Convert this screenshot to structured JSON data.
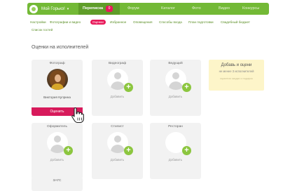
{
  "header": {
    "brand": "Мой Горько!",
    "nav": [
      {
        "label": "Переписка",
        "badge": "0",
        "active": true
      },
      {
        "label": "Форум"
      },
      {
        "label": "Каталог"
      },
      {
        "label": "Фото"
      },
      {
        "label": "Видео"
      },
      {
        "label": "Конкурсы"
      }
    ]
  },
  "subnav": [
    {
      "label": "Настройки"
    },
    {
      "label": "Фотографии и видео"
    },
    {
      "label": "Оценки",
      "active": true
    },
    {
      "label": "Избранное"
    },
    {
      "label": "Оповещения"
    },
    {
      "label": "Способы входа"
    },
    {
      "label": "План подготовки"
    },
    {
      "label": "Свадебный бюджет"
    },
    {
      "label": "Список гостей"
    }
  ],
  "page_title": "Оценки на исполнителей",
  "cards": [
    {
      "title": "Фотограф",
      "name": "Виктория Куприна",
      "action": "Оценить"
    },
    {
      "title": "Видеограф",
      "action": "Добавить"
    },
    {
      "title": "Ведущий",
      "action": "Добавить"
    },
    {
      "title": "Оформитель",
      "action": "Добавить"
    },
    {
      "title": "Стилист",
      "action": "Добавить"
    },
    {
      "title": "Ресторан",
      "action": "Добавить"
    },
    {
      "title": "ЗАГС"
    }
  ],
  "promo": {
    "title": "Добавь и оцени",
    "subtitle": "не менее 3 исполнителей",
    "faint": "гарантия скидки и подарок"
  }
}
